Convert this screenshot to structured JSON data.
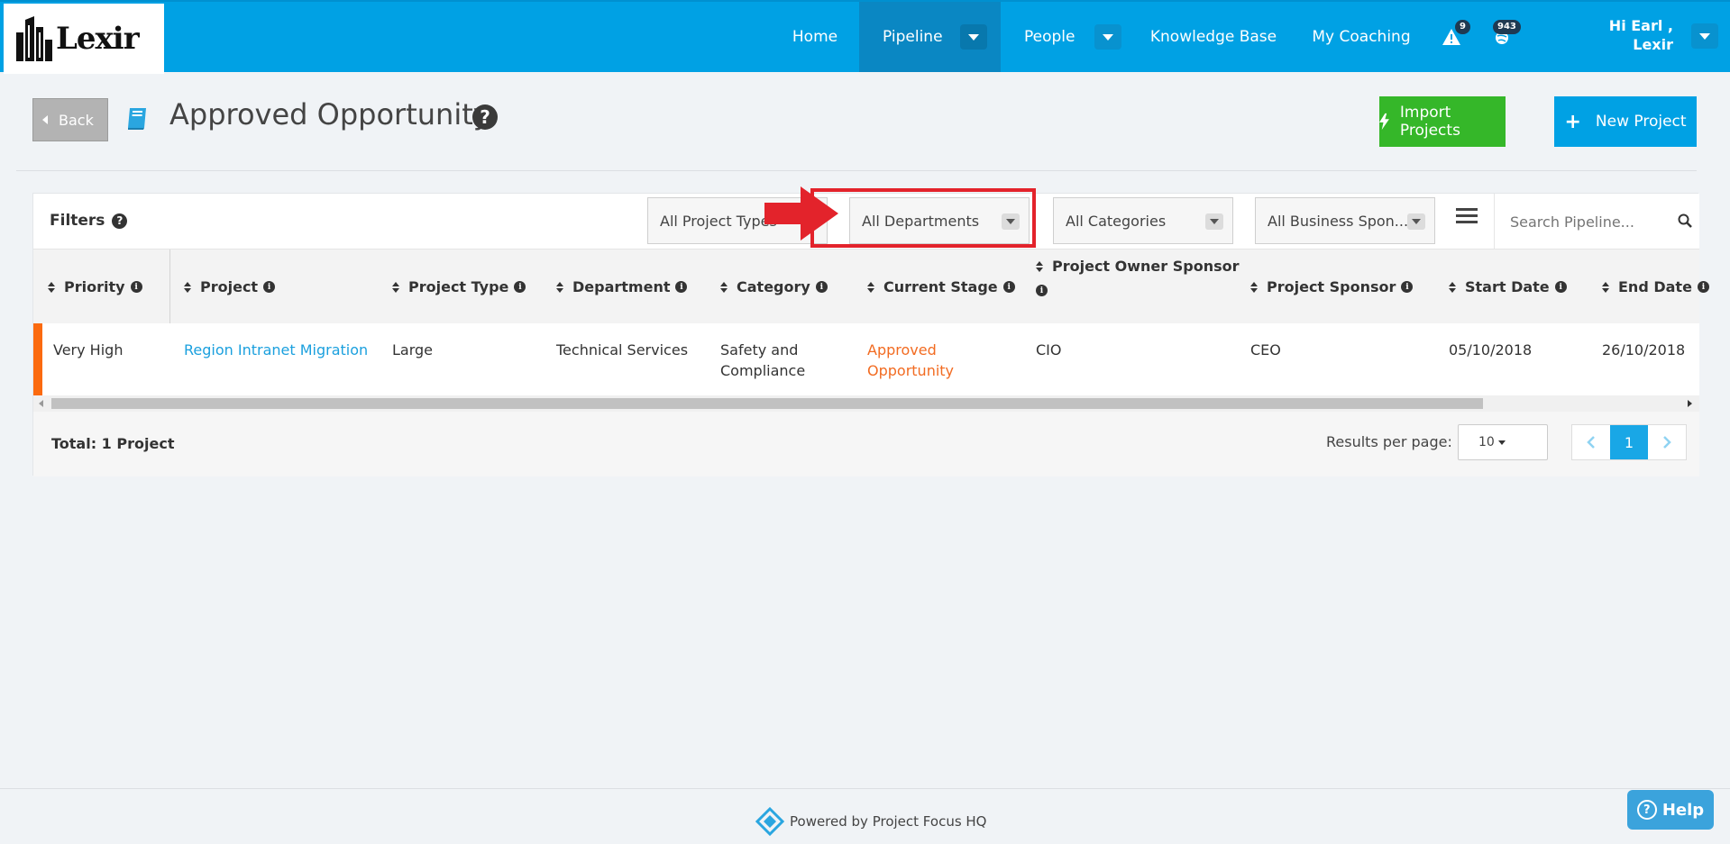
{
  "app": {
    "logo_text": "Lexir"
  },
  "nav": {
    "items": [
      {
        "label": "Home"
      },
      {
        "label": "Pipeline"
      },
      {
        "label": "People"
      },
      {
        "label": "Knowledge Base"
      },
      {
        "label": "My Coaching"
      }
    ],
    "alerts_count": "9",
    "globe_count": "943",
    "user_greeting_line1": "Hi Earl ,",
    "user_greeting_line2": "Lexir"
  },
  "page": {
    "back_label": "Back",
    "title": "Approved Opportunity",
    "help_glyph": "?",
    "import_label": "Import Projects",
    "new_label": "New Project"
  },
  "filters": {
    "label": "Filters",
    "project_types": "All Project Types",
    "departments": "All Departments",
    "categories": "All Categories",
    "business_sponsor": "All Business Spon...",
    "search_placeholder": "Search Pipeline..."
  },
  "table": {
    "columns": [
      "Priority",
      "Project",
      "Project Type",
      "Department",
      "Category",
      "Current Stage",
      "Project Owner Sponsor",
      "Project Sponsor",
      "Start Date",
      "End Date"
    ],
    "rows": [
      {
        "priority": "Very High",
        "project": "Region Intranet Migration",
        "project_type": "Large",
        "department": "Technical Services",
        "category_line1": "Safety and",
        "category_line2": "Compliance",
        "stage_line1": "Approved",
        "stage_line2": "Opportunity",
        "owner_sponsor": "CIO",
        "sponsor": "CEO",
        "start_date": "05/10/2018",
        "end_date": "26/10/2018"
      }
    ]
  },
  "footer": {
    "total": "Total: 1 Project",
    "results_per_page_label": "Results per page:",
    "results_per_page_value": "10",
    "current_page": "1",
    "powered_by": "Powered by Project Focus HQ",
    "help_label": "Help"
  },
  "colors": {
    "brand": "#00a1e4",
    "import_button": "#35b729",
    "priority_flag": "#fb6a0f",
    "highlight": "#e3232b"
  }
}
